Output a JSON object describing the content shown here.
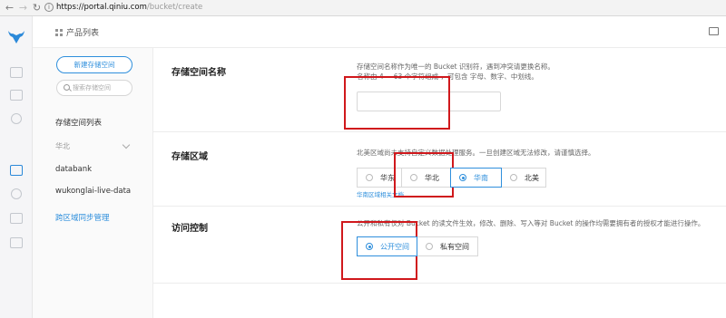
{
  "browser": {
    "url_host": "https://portal.qiniu.com",
    "url_path": "/bucket/create"
  },
  "topbar": {
    "product_list": "产品列表"
  },
  "sidebar": {
    "new_bucket": "新建存储空间",
    "search_placeholder": "搜索存储空间",
    "list_title": "存储空间列表",
    "region_filter": "华北",
    "buckets": [
      "databank",
      "wukonglai-live-data"
    ],
    "cross_region_sync": "跨区域同步管理"
  },
  "form": {
    "name": {
      "label": "存储空间名称",
      "desc_line1": "存储空间名称作为唯一的 Bucket 识别符，遇到冲突请更换名称。",
      "desc_line2": "名称由 4 ~ 63 个字符组成 ，可包含 字母、数字、中划线。",
      "value": ""
    },
    "region": {
      "label": "存储区域",
      "desc": "北美区域尚未支持自定义数据处理服务。一旦创建区域无法修改，请谨慎选择。",
      "options": [
        "华东",
        "华北",
        "华南",
        "北美"
      ],
      "selected": "华南",
      "doc_link": "华南区域相关文档"
    },
    "access": {
      "label": "访问控制",
      "desc": "公开和私有仅对 Bucket 的读文件生效，修改、删除、写入等对 Bucket 的操作均需要拥有者的授权才能进行操作。",
      "options": [
        "公开空间",
        "私有空间"
      ],
      "selected": "公开空间"
    }
  },
  "colors": {
    "accent": "#2f8fdc",
    "annotation_red": "#d0181c"
  }
}
